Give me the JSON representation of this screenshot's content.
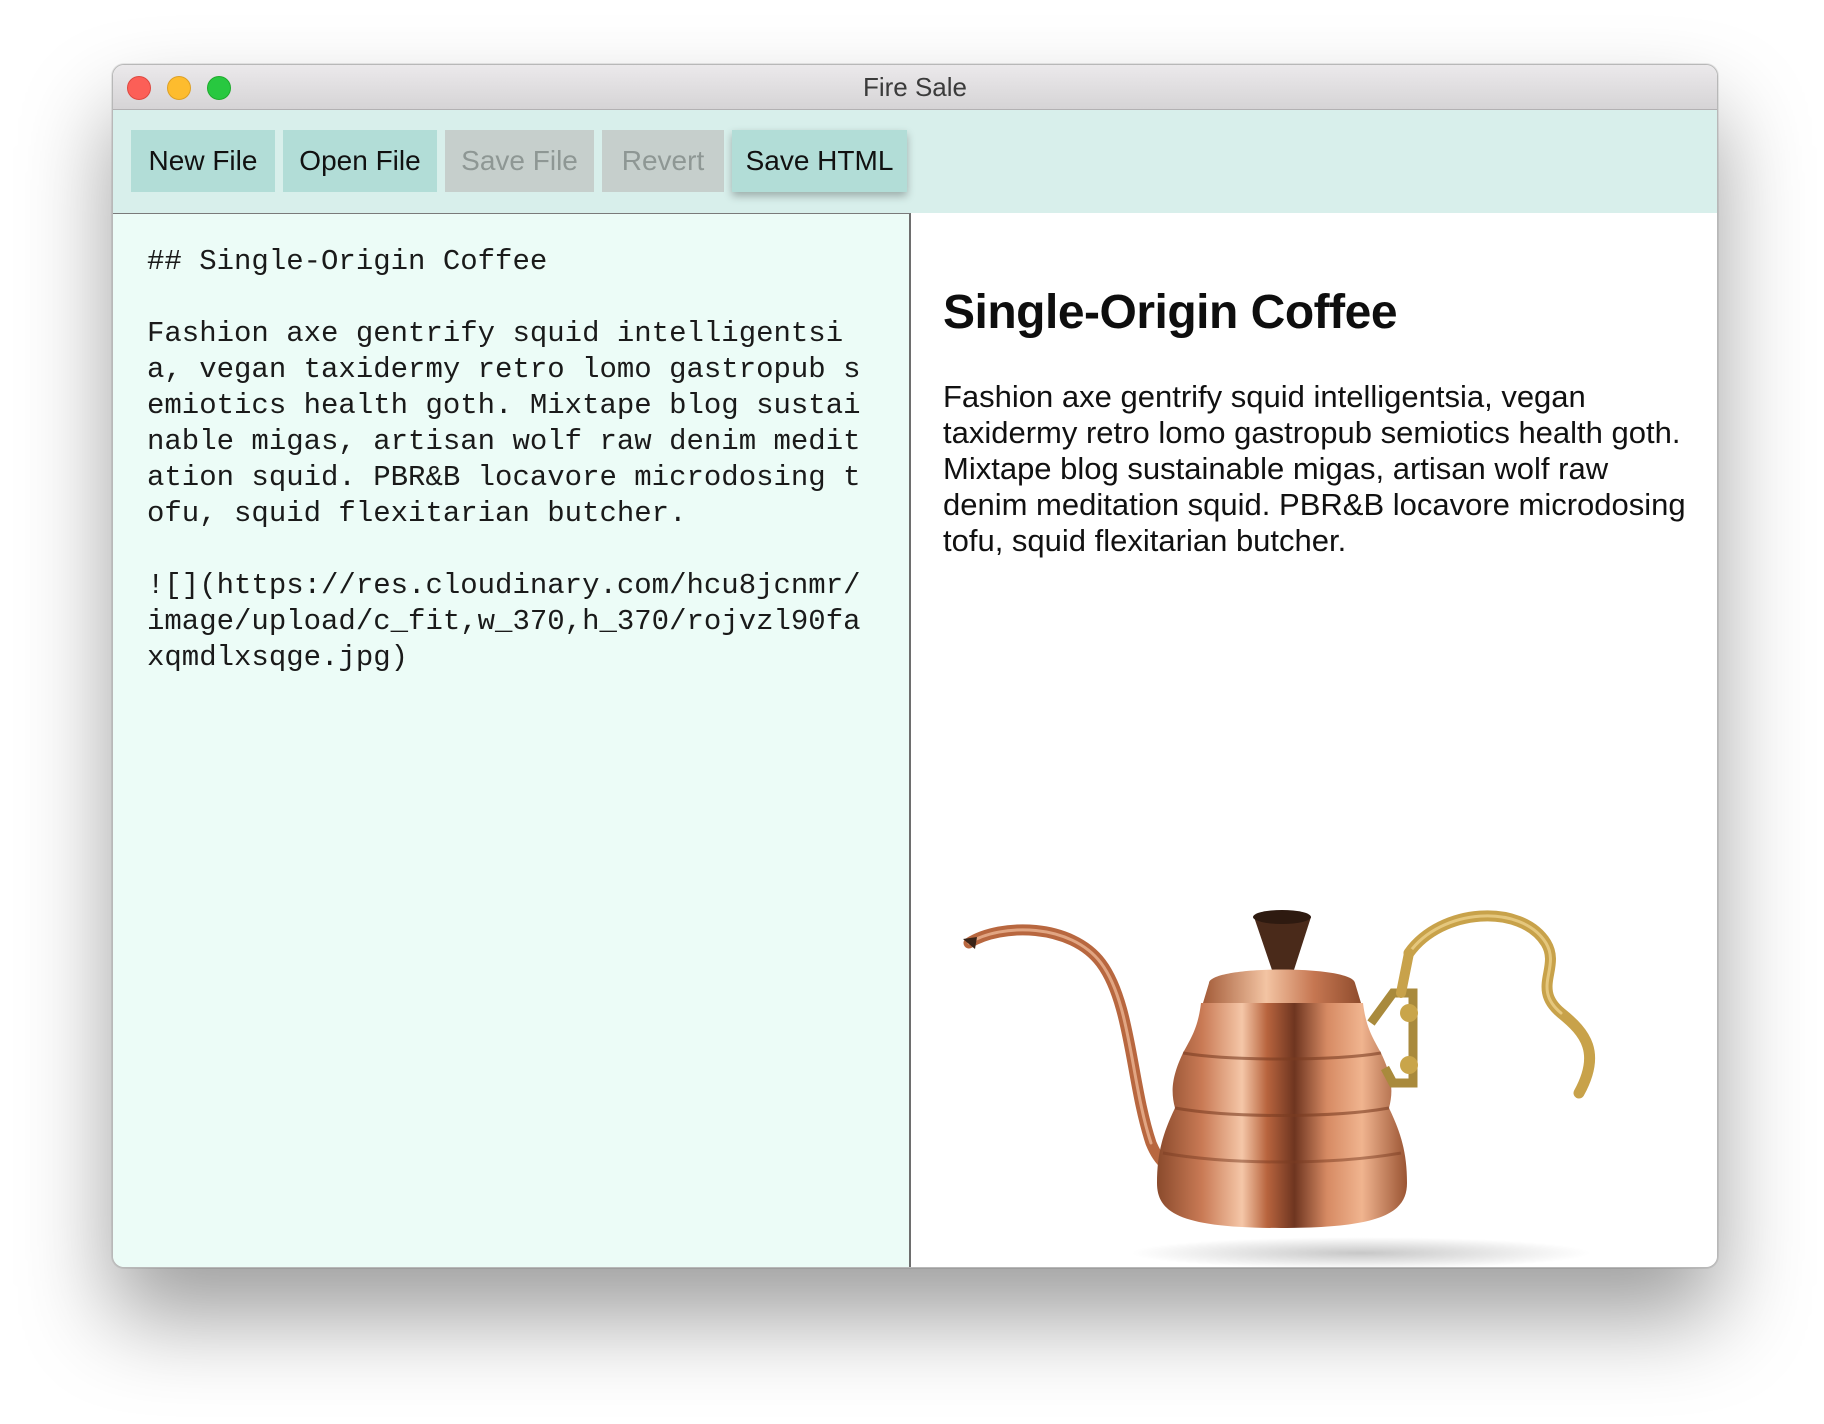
{
  "window": {
    "title": "Fire Sale"
  },
  "toolbar": {
    "new_file": "New File",
    "open_file": "Open File",
    "save_file": "Save File",
    "revert": "Revert",
    "save_html": "Save HTML"
  },
  "editor": {
    "markdown": "## Single-Origin Coffee\n\nFashion axe gentrify squid intelligentsia, vegan taxidermy retro lomo gastropub semiotics health goth. Mixtape blog sustainable migas, artisan wolf raw denim meditation squid. PBR&B locavore microdosing tofu, squid flexitarian butcher.\n\n![](https://res.cloudinary.com/hcu8jcnmr/image/upload/c_fit,w_370,h_370/rojvzl90faxqmdlxsqge.jpg)"
  },
  "preview": {
    "heading": "Single-Origin Coffee",
    "paragraph": "Fashion axe gentrify squid intelligentsia, vegan taxidermy retro lomo gastropub semiotics health goth. Mixtape blog sustainable migas, artisan wolf raw denim meditation squid. PBR&B locavore microdosing tofu, squid flexitarian butcher.",
    "image": "copper-pour-over-kettle"
  },
  "colors": {
    "toolbar_bg": "#d8efeb",
    "button_bg": "#b2ddd7",
    "button_disabled_bg": "#c6cfcc",
    "editor_bg": "#ecfcf7"
  }
}
